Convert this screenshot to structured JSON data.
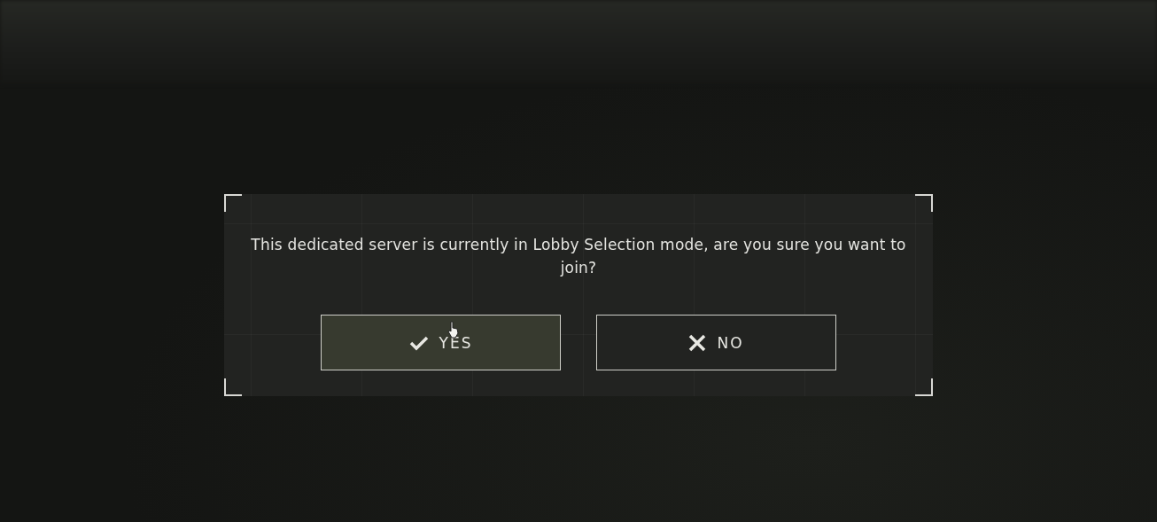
{
  "dialog": {
    "message": "This dedicated server is currently in Lobby Selection mode, are you sure you want to join?",
    "buttons": [
      {
        "kind": "confirm",
        "label": "YES",
        "selected": true
      },
      {
        "kind": "cancel",
        "label": "NO",
        "selected": false
      }
    ]
  }
}
